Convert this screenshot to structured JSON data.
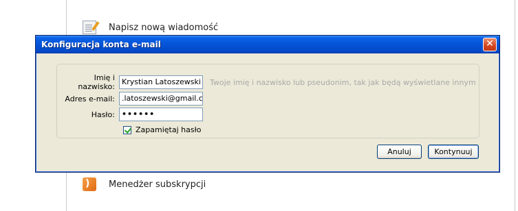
{
  "background": {
    "items": [
      {
        "label": "Napisz nową wiadomość",
        "icon": "compose-icon"
      },
      {
        "label": "Menedżer subskrypcji",
        "icon": "rss-icon"
      }
    ]
  },
  "dialog": {
    "title": "Konfiguracja konta e-mail",
    "fields": {
      "name": {
        "label": "Imię i nazwisko:",
        "value": "Krystian Latoszewski",
        "hint": "Twoje imię i nazwisko lub pseudonim, tak jak będą wyświetlane innym"
      },
      "email": {
        "label": "Adres e-mail:",
        "value": ".latoszewski@gmail.com"
      },
      "password": {
        "label": "Hasło:",
        "value": "••••••"
      }
    },
    "remember": {
      "label": "Zapamiętaj hasło",
      "checked": true
    },
    "buttons": {
      "cancel": "Anuluj",
      "continue": "Kontynuuj"
    }
  },
  "colors": {
    "titlebar": "#0553d6",
    "dialog_bg": "#ece9d8",
    "close": "#d2451e"
  }
}
